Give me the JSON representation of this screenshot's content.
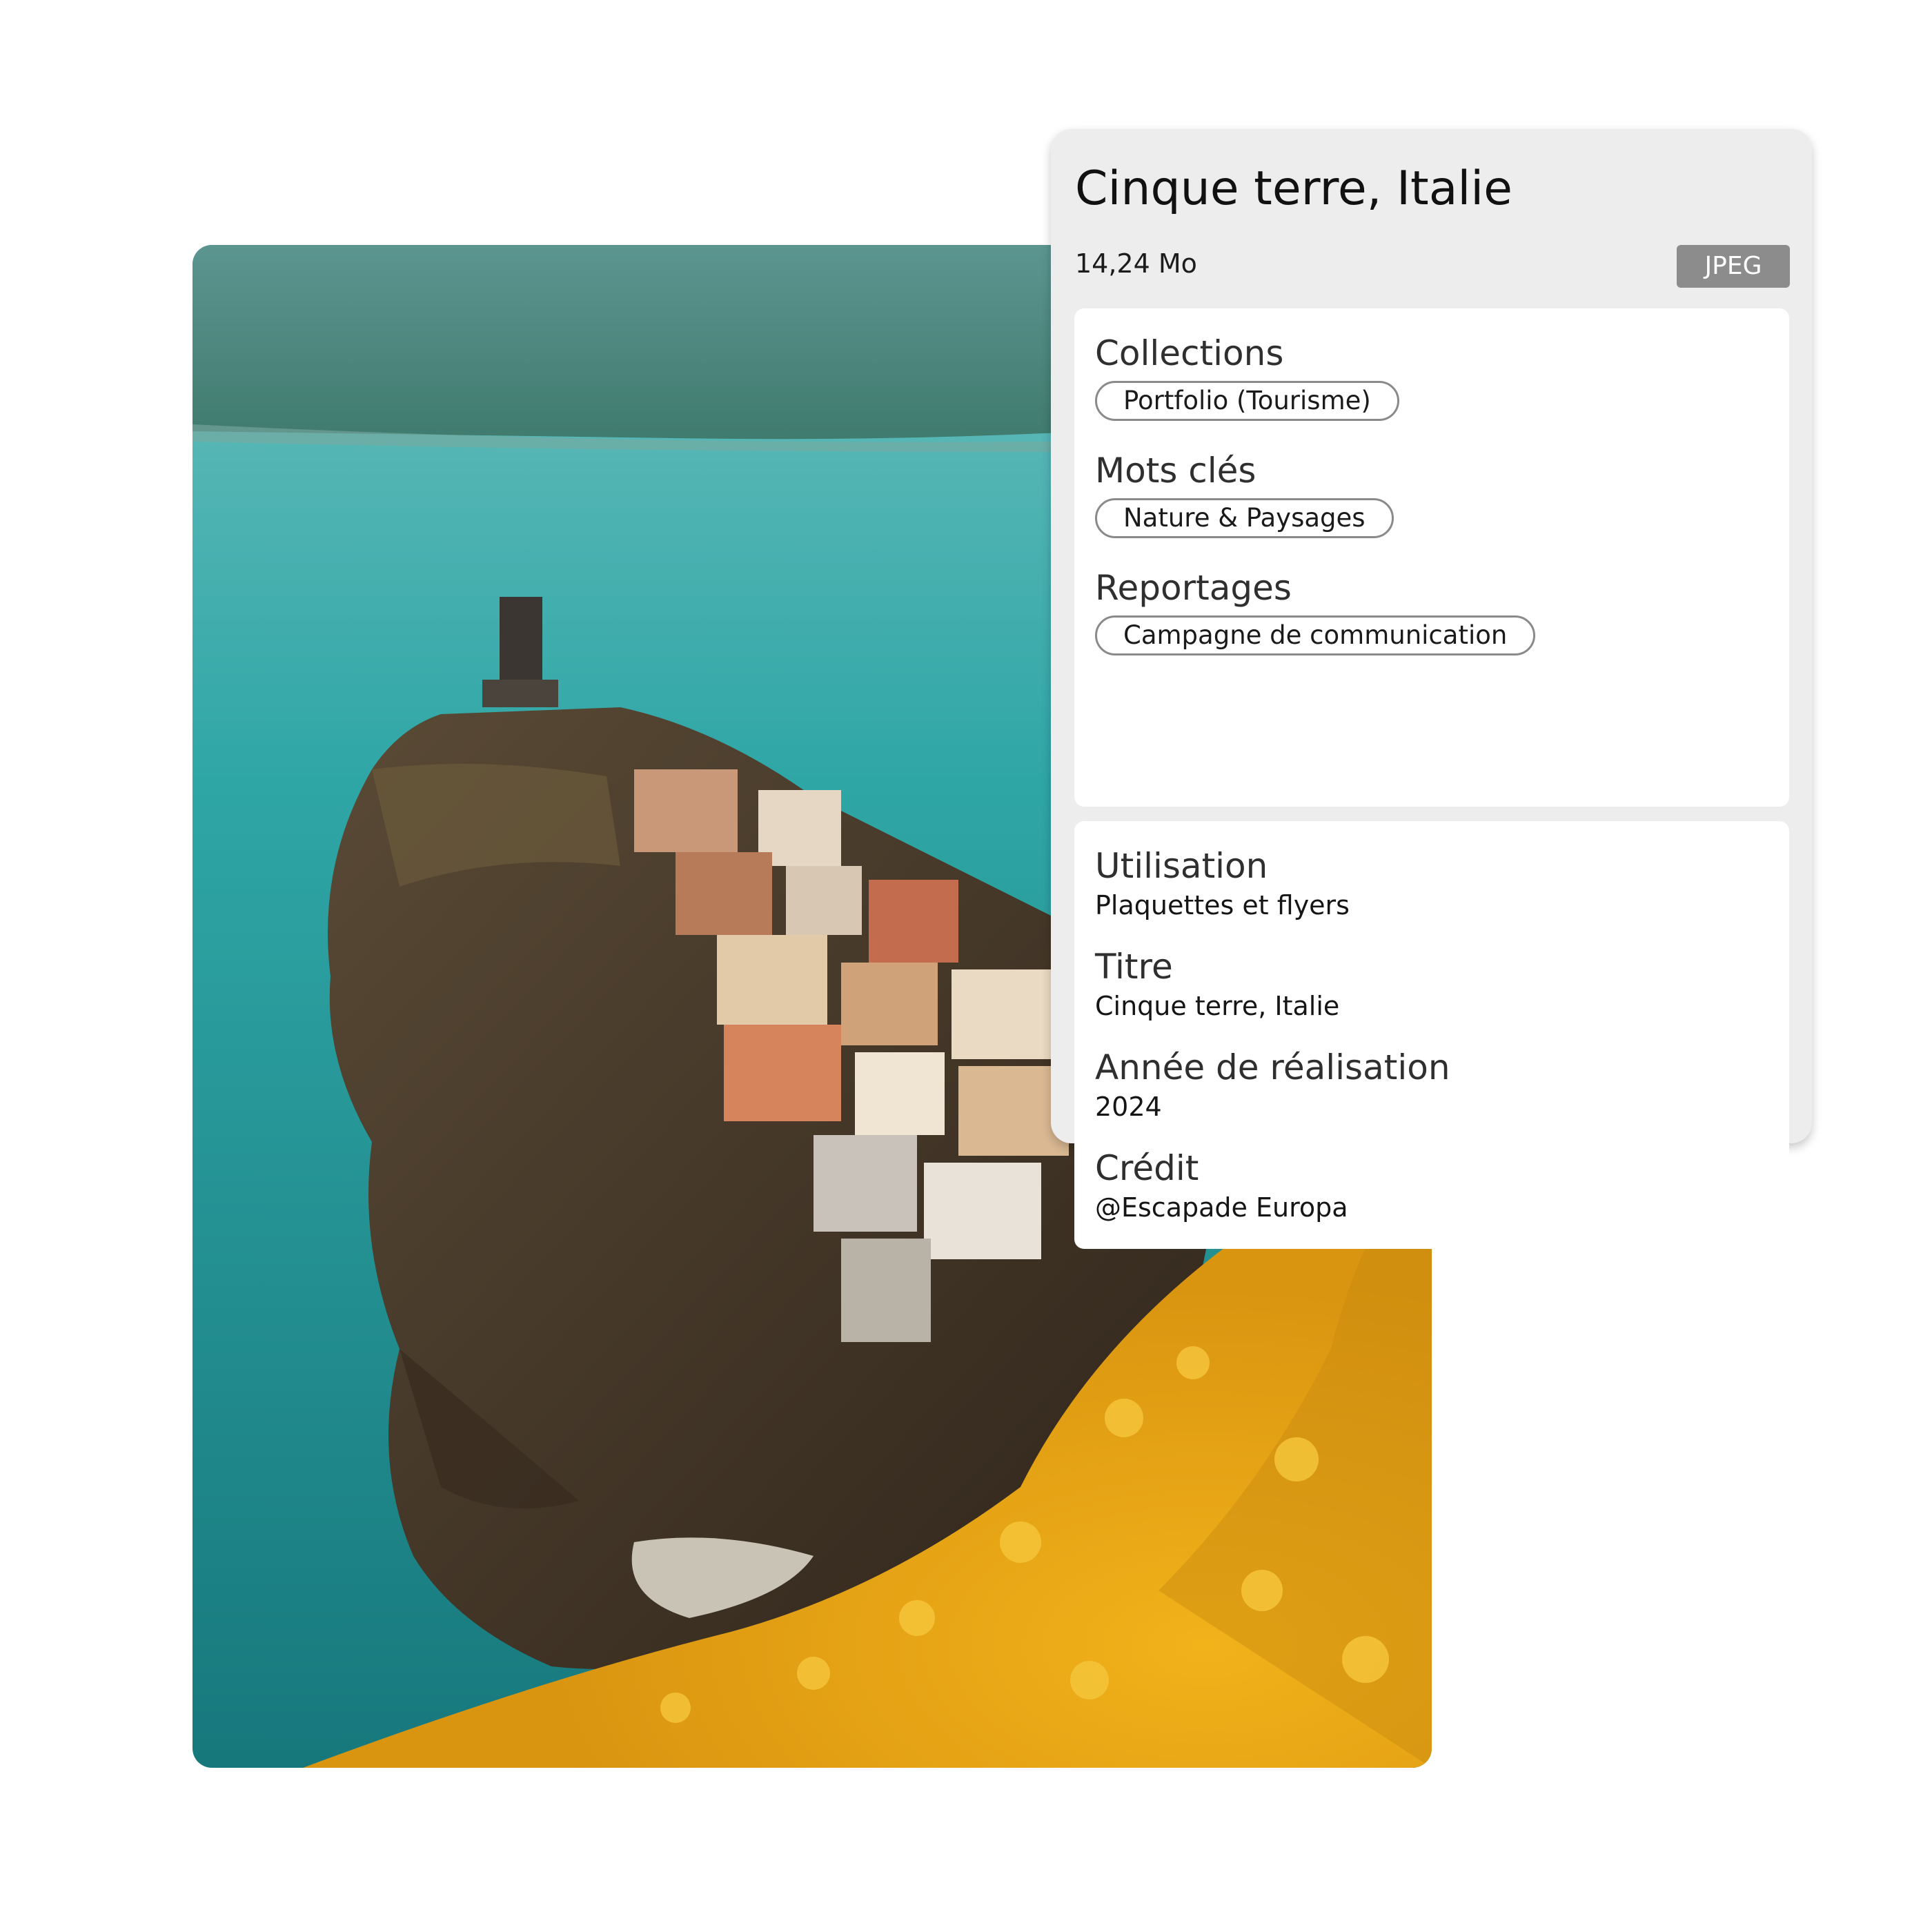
{
  "photo": {
    "alt_icon": "landscape-photo",
    "colors": {
      "sky_hills": "#4f8a86",
      "sea": "#2c9ea0",
      "rock": "#4a3a2a",
      "flowers": "#e9a916"
    }
  },
  "panel": {
    "title": "Cinque terre, Italie",
    "size": "14,24 Mo",
    "format": "JPEG",
    "sections": [
      {
        "label": "Collections",
        "tag": "Portfolio (Tourisme)"
      },
      {
        "label": "Mots clés",
        "tag": "Nature & Paysages"
      },
      {
        "label": "Reportages",
        "tag": "Campagne de communication"
      }
    ],
    "meta": [
      {
        "label": "Utilisation",
        "value": "Plaquettes et flyers"
      },
      {
        "label": "Titre",
        "value": "Cinque terre, Italie"
      },
      {
        "label": "Année de réalisation",
        "value": "2024"
      },
      {
        "label": "Crédit",
        "value": "@Escapade Europa"
      }
    ]
  }
}
